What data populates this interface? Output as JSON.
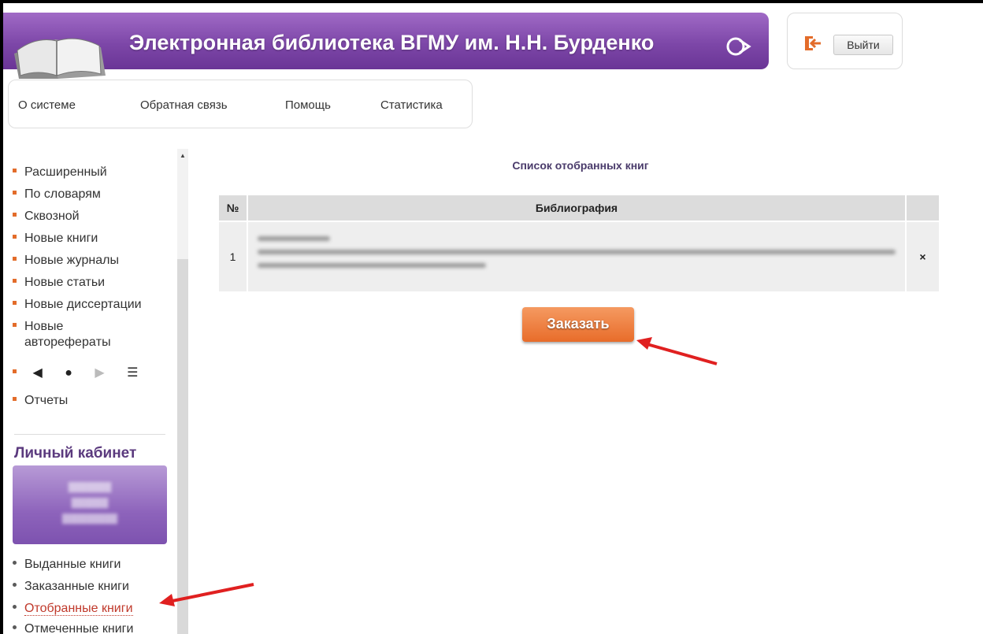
{
  "header": {
    "title": "Электронная библиотека ВГМУ им. Н.Н. Бурденко",
    "logout_label": "Выйти"
  },
  "topnav": {
    "items": [
      {
        "label": "О системе"
      },
      {
        "label": "Обратная связь"
      },
      {
        "label": "Помощь"
      },
      {
        "label": "Статистика"
      }
    ]
  },
  "sidebar": {
    "search_items": [
      {
        "label": "Расширенный"
      },
      {
        "label": "По словарям"
      },
      {
        "label": "Сквозной"
      },
      {
        "label": "Новые книги"
      },
      {
        "label": "Новые журналы"
      },
      {
        "label": "Новые статьи"
      },
      {
        "label": "Новые диссертации"
      },
      {
        "label": "Новые"
      },
      {
        "label": "автореферaты"
      }
    ],
    "reports_label": "Отчеты",
    "cabinet_title": "Личный кабинет",
    "cabinet_items": [
      {
        "label": "Выданные книги"
      },
      {
        "label": "Заказанные книги"
      },
      {
        "label": "Отобранные книги"
      },
      {
        "label": "Отмеченные книги"
      }
    ]
  },
  "main": {
    "list_title": "Список отобранных книг",
    "table": {
      "columns": [
        "№",
        "Библиография",
        ""
      ],
      "rows": [
        {
          "num": "1",
          "remove": "×"
        }
      ]
    },
    "order_button": "Заказать"
  },
  "colors": {
    "accent_purple": "#7d47a8",
    "order_orange": "#e86c2a",
    "annotation_red": "#e02020"
  }
}
